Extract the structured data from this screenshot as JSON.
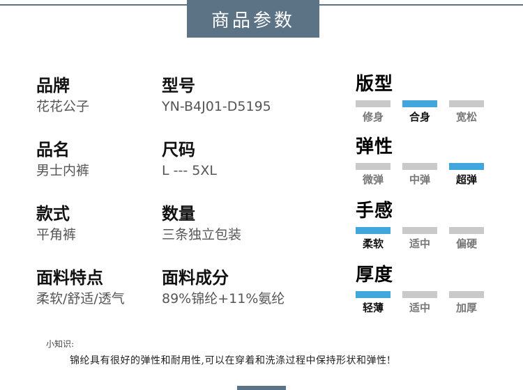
{
  "header": {
    "title": "商品参数"
  },
  "params": [
    {
      "label": "品牌",
      "value": "花花公子"
    },
    {
      "label": "型号",
      "value": "YN-B4J01-D5195"
    },
    {
      "label": "品名",
      "value": "男士内裤"
    },
    {
      "label": "尺码",
      "value": "L --- 5XL"
    },
    {
      "label": "款式",
      "value": "平角裤"
    },
    {
      "label": "数量",
      "value": "三条独立包装"
    },
    {
      "label": "面料特点",
      "value": "柔软/舒适/透气"
    },
    {
      "label": "面料成分",
      "value": "89%锦纶+11%氨纶"
    }
  ],
  "ratings": [
    {
      "title": "版型",
      "options": [
        "修身",
        "合身",
        "宽松"
      ],
      "selected": 1
    },
    {
      "title": "弹性",
      "options": [
        "微弹",
        "中弹",
        "超弹"
      ],
      "selected": 2
    },
    {
      "title": "手感",
      "options": [
        "柔软",
        "适中",
        "偏硬"
      ],
      "selected": 0
    },
    {
      "title": "厚度",
      "options": [
        "轻薄",
        "适中",
        "加厚"
      ],
      "selected": 0
    }
  ],
  "tip": {
    "title": "小知识:",
    "body": "锦纶具有很好的弹性和耐用性,可以在穿着和洗涤过程中保持形状和弹性!"
  },
  "colors": {
    "accent": "#5b7385",
    "selected": "#41a6dc",
    "unselected": "#c9c9c9"
  }
}
